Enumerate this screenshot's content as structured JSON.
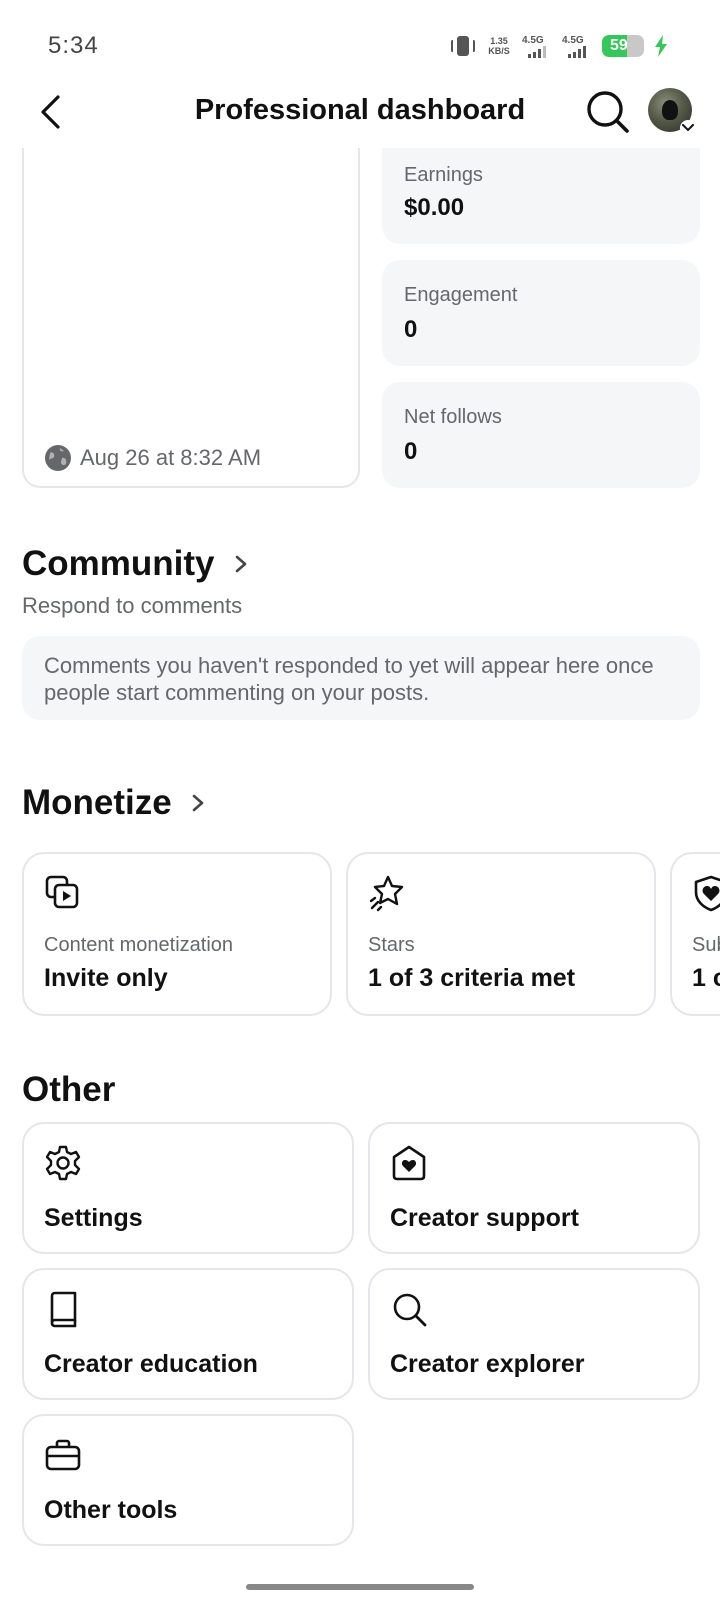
{
  "status_bar": {
    "time": "5:34",
    "net_speed_value": "1.35",
    "net_speed_unit": "KB/S",
    "signal1_label": "4.5G",
    "signal2_label": "4.5G",
    "battery_level": "59",
    "battery_fraction": 0.59,
    "charging": true
  },
  "header": {
    "title": "Professional dashboard"
  },
  "post": {
    "date": "Aug 26 at 8:32 AM"
  },
  "metrics": [
    {
      "label": "Earnings",
      "value": "$0.00"
    },
    {
      "label": "Engagement",
      "value": "0"
    },
    {
      "label": "Net follows",
      "value": "0"
    }
  ],
  "community": {
    "title": "Community",
    "subtitle": "Respond to comments",
    "empty_message": "Comments you haven't responded to yet will appear here once people start commenting on your posts."
  },
  "monetize": {
    "title": "Monetize",
    "cards": [
      {
        "label": "Content monetization",
        "value": "Invite only",
        "icon": "content-monetization-icon"
      },
      {
        "label": "Stars",
        "value": "1 of 3 criteria met",
        "icon": "stars-icon"
      },
      {
        "label": "Sub",
        "value": "1 c",
        "icon": "subscriptions-heart-icon"
      }
    ]
  },
  "other": {
    "title": "Other",
    "tools": [
      {
        "label": "Settings",
        "icon": "gear-icon"
      },
      {
        "label": "Creator support",
        "icon": "home-heart-icon"
      },
      {
        "label": "Creator education",
        "icon": "book-icon"
      },
      {
        "label": "Creator explorer",
        "icon": "search-icon"
      },
      {
        "label": "Other tools",
        "icon": "briefcase-icon"
      }
    ]
  }
}
